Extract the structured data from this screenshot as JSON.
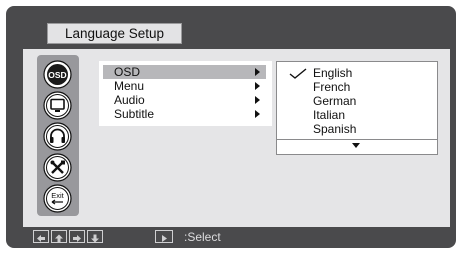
{
  "title": "Language Setup",
  "sidebar": {
    "icons": [
      {
        "name": "osd-icon",
        "label": "OSD",
        "selected": true
      },
      {
        "name": "monitor-icon",
        "label": "",
        "selected": false
      },
      {
        "name": "headphones-icon",
        "label": "",
        "selected": false
      },
      {
        "name": "tools-icon",
        "label": "",
        "selected": false
      },
      {
        "name": "exit-icon",
        "label": "Exit",
        "selected": false
      }
    ]
  },
  "menu": {
    "items": [
      {
        "label": "OSD",
        "selected": true
      },
      {
        "label": "Menu",
        "selected": false
      },
      {
        "label": "Audio",
        "selected": false
      },
      {
        "label": "Subtitle",
        "selected": false
      }
    ]
  },
  "languages": {
    "items": [
      "English",
      "French",
      "German",
      "Italian",
      "Spanish"
    ],
    "checked": "English"
  },
  "footer": {
    "nav_icons": [
      "left-arrow-icon",
      "up-arrow-icon",
      "right-arrow-icon",
      "down-arrow-icon"
    ],
    "select_icon": "play-icon",
    "select_label": ":Select"
  },
  "colors": {
    "frame": "#4a4a4c",
    "panel": "#e5e5e7",
    "icon_column": "#98989c",
    "highlight": "#b7b7ba"
  }
}
